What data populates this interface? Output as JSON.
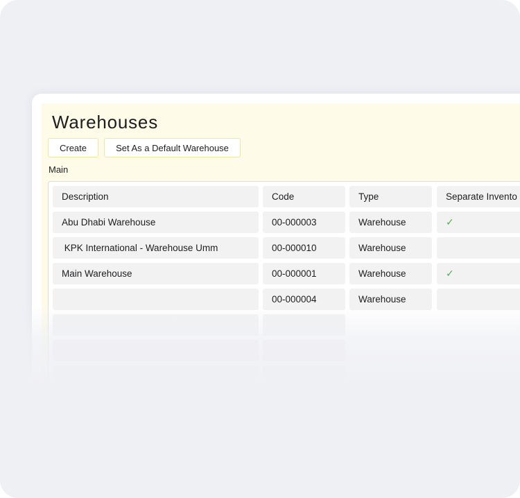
{
  "page": {
    "title": "Warehouses"
  },
  "toolbar": {
    "create_label": "Create",
    "set_default_label": "Set As a Default Warehouse"
  },
  "group": {
    "label": "Main"
  },
  "table": {
    "columns": [
      "Description",
      "Code",
      "Type",
      "Separate Invento"
    ],
    "rows": [
      {
        "description": "Abu Dhabi Warehouse",
        "code": "00-000003",
        "type": "Warehouse",
        "separate_inventory": "✓"
      },
      {
        "description": " KPK International - Warehouse Umm",
        "code": "00-000010",
        "type": "Warehouse",
        "separate_inventory": ""
      },
      {
        "description": "Main Warehouse",
        "code": "00-000001",
        "type": "Warehouse",
        "separate_inventory": "✓"
      },
      {
        "description": "",
        "code": "00-000004",
        "type": "Warehouse",
        "separate_inventory": ""
      }
    ]
  },
  "colors": {
    "panel_background": "#fefbe8",
    "button_border": "#f1e5a3",
    "cell_background": "#f2f2f3",
    "check_color": "#4caf50",
    "page_background": "#eff0f4"
  },
  "icons": {
    "check": "check-icon"
  }
}
